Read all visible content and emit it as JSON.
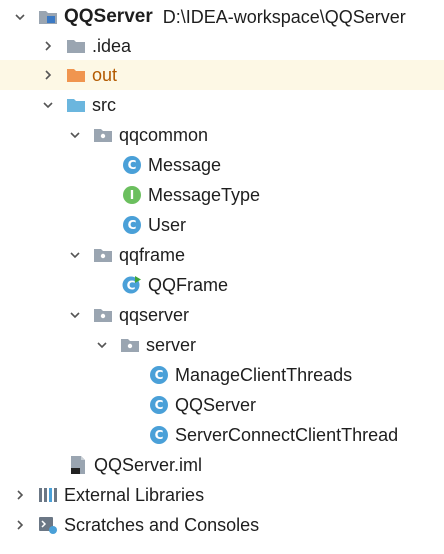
{
  "project": {
    "name": "QQServer",
    "path": "D:\\IDEA-workspace\\QQServer"
  },
  "nodes": {
    "idea": ".idea",
    "out": "out",
    "src": "src",
    "qqcommon": "qqcommon",
    "message": "Message",
    "message_type": "MessageType",
    "user": "User",
    "qqframe": "qqframe",
    "qqframe_class": "QQFrame",
    "qqserver": "qqserver",
    "server": "server",
    "manage_client_threads": "ManageClientThreads",
    "qqserver_class": "QQServer",
    "server_connect_client_thread": "ServerConnectClientThread",
    "iml": "QQServer.iml",
    "external_libraries": "External Libraries",
    "scratches": "Scratches and Consoles"
  },
  "colors": {
    "selection": "#fdf8e5",
    "folder_gray": "#9aa5b1",
    "folder_orange": "#f0954f",
    "folder_blue": "#6bb6de",
    "class_icon": "#4aa0d8",
    "enum_icon": "#6bbf5e"
  }
}
